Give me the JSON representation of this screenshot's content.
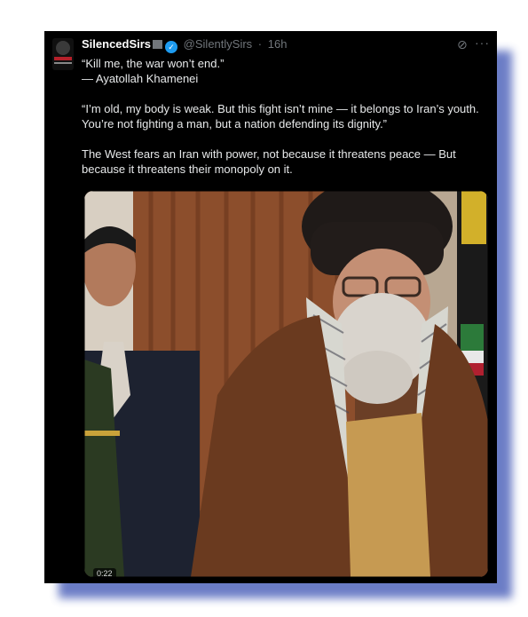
{
  "post": {
    "display_name": "SilencedSirs",
    "handle": "@SilentlySirs",
    "separator": "·",
    "timestamp": "16h",
    "verified_glyph": "✓",
    "grok_glyph": "⊘",
    "more_glyph": "···",
    "lines": [
      "“Kill me, the war won’t end.”",
      "— Ayatollah Khamenei",
      "",
      "“I’m old, my body is weak. But this fight isn’t mine — it belongs to Iran’s youth. You’re not fighting a man, but a nation defending its dignity.”",
      "",
      "The West fears an Iran with power, not because it threatens peace — But because it threatens their monopoly on it."
    ]
  },
  "media": {
    "video_time": "0:22",
    "description_icon": "video-frame"
  },
  "colors": {
    "card_bg": "#000000",
    "shadow": "#5c6fc0",
    "text": "#e7e9ea",
    "muted": "#71767b",
    "verified": "#1d9bf0"
  }
}
